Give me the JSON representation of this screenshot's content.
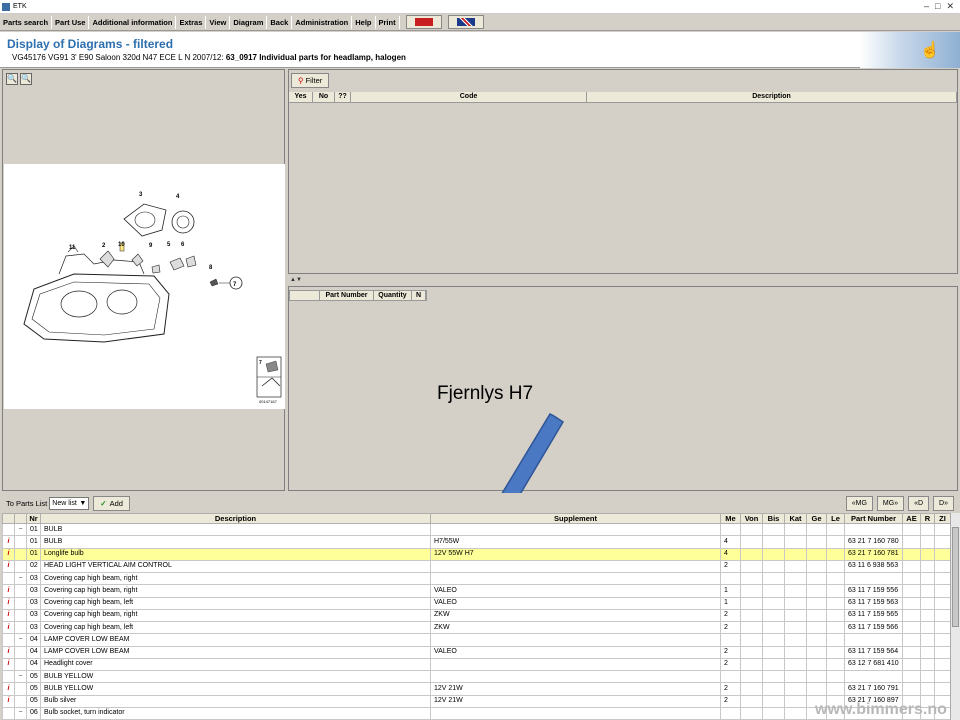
{
  "window": {
    "title": "ETK"
  },
  "menu": [
    "Parts search",
    "Part Use",
    "Additional information",
    "Extras",
    "View",
    "Diagram",
    "Back",
    "Administration",
    "Help",
    "Print"
  ],
  "header": {
    "title": "Display of Diagrams - filtered",
    "vehicle": "VG45176 VG91 3' E90 Saloon 320d N47 ECE L N 2007/12:",
    "diagram": "63_0917 Individual parts for headlamp, halogen"
  },
  "diagram_labels": [
    "3",
    "4",
    "11",
    "2",
    "10",
    "9",
    "5",
    "6",
    "8",
    "7",
    "7",
    "00147167"
  ],
  "filter_label": "Filter",
  "top_grid_headers": [
    "Yes",
    "No",
    "??",
    "Code",
    "Description"
  ],
  "mid_grid_headers": [
    "Part Number",
    "Quantity",
    "N"
  ],
  "annotation": "Fjernlys H7",
  "toolbar": {
    "to_parts_list": "To Parts List",
    "list_value": "New list",
    "add": "Add",
    "nav": [
      "«MG",
      "MG»",
      "«D",
      "D»"
    ]
  },
  "table": {
    "headers": [
      "",
      "",
      "Nr",
      "Description",
      "Supplement",
      "Me",
      "Von",
      "Bis",
      "Kat",
      "Ge",
      "Le",
      "Part Number",
      "AE",
      "R",
      "ZI"
    ],
    "rows": [
      {
        "mark": "−",
        "nr": "01",
        "desc": "BULB",
        "supp": "",
        "me": "",
        "pn": ""
      },
      {
        "mark": "i",
        "nr": "01",
        "desc": "BULB",
        "supp": "H7/55W",
        "me": "4",
        "pn": "63 21 7 160 780"
      },
      {
        "mark": "i",
        "nr": "01",
        "desc": "Longlife bulb",
        "supp": "12V 55W H7",
        "me": "4",
        "pn": "63 21 7 160 781",
        "hl": true
      },
      {
        "mark": "i",
        "nr": "02",
        "desc": "HEAD LIGHT VERTICAL AIM CONTROL",
        "supp": "",
        "me": "2",
        "pn": "63 11 6 938 563"
      },
      {
        "mark": "−",
        "nr": "03",
        "desc": "Covering cap high beam, right",
        "supp": "",
        "me": "",
        "pn": ""
      },
      {
        "mark": "i",
        "nr": "03",
        "desc": "Covering cap high beam, right",
        "supp": "VALEO",
        "me": "1",
        "pn": "63 11 7 159 556"
      },
      {
        "mark": "i",
        "nr": "03",
        "desc": "Covering cap high beam, left",
        "supp": "VALEO",
        "me": "1",
        "pn": "63 11 7 159 563"
      },
      {
        "mark": "i",
        "nr": "03",
        "desc": "Covering cap high beam, right",
        "supp": "ZKW",
        "me": "2",
        "pn": "63 11 7 159 565"
      },
      {
        "mark": "i",
        "nr": "03",
        "desc": "Covering cap high beam, left",
        "supp": "ZKW",
        "me": "2",
        "pn": "63 11 7 159 566"
      },
      {
        "mark": "−",
        "nr": "04",
        "desc": "LAMP COVER LOW BEAM",
        "supp": "",
        "me": "",
        "pn": ""
      },
      {
        "mark": "i",
        "nr": "04",
        "desc": "LAMP COVER LOW BEAM",
        "supp": "VALEO",
        "me": "2",
        "pn": "63 11 7 159 564"
      },
      {
        "mark": "i",
        "nr": "04",
        "desc": "Headlight cover",
        "supp": "",
        "me": "2",
        "pn": "63 12 7 681 410"
      },
      {
        "mark": "−",
        "nr": "05",
        "desc": "BULB YELLOW",
        "supp": "",
        "me": "",
        "pn": ""
      },
      {
        "mark": "i",
        "nr": "05",
        "desc": "BULB YELLOW",
        "supp": "12V 21W",
        "me": "2",
        "pn": "63 21 7 160 791"
      },
      {
        "mark": "i",
        "nr": "05",
        "desc": "Bulb silver",
        "supp": "12V 21W",
        "me": "2",
        "pn": "63 21 7 160 897"
      },
      {
        "mark": "−",
        "nr": "06",
        "desc": "Bulb socket, turn indicator",
        "supp": "",
        "me": "",
        "pn": ""
      }
    ]
  },
  "watermark": "www.bimmers.no",
  "colors": {
    "title_blue": "#2d6fae",
    "highlight": "#ffff99",
    "arrow": "#4a78c2"
  }
}
